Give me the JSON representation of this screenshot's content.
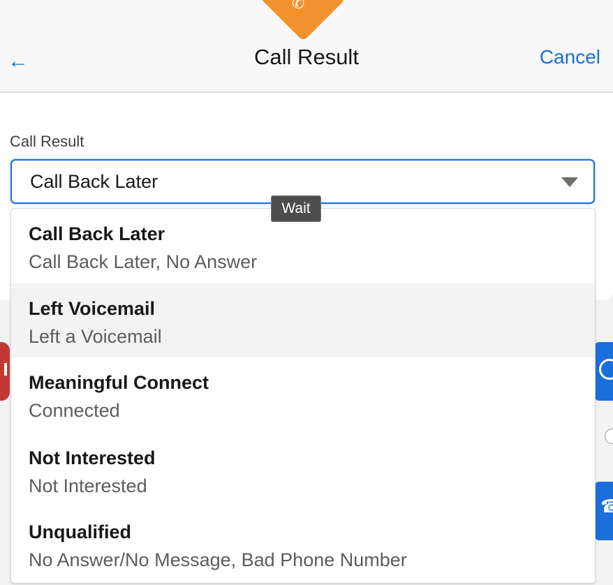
{
  "header": {
    "title": "Call Result",
    "cancel_label": "Cancel",
    "back_icon": "arrow-left-icon",
    "badge_icon": "phone-icon"
  },
  "form": {
    "field_label": "Call Result",
    "selected_value": "Call Back Later"
  },
  "tooltip": {
    "text": "Wait"
  },
  "dropdown": {
    "options": [
      {
        "title": "Call Back Later",
        "subtitle": "Call Back Later, No Answer"
      },
      {
        "title": "Left Voicemail",
        "subtitle": "Left a Voicemail"
      },
      {
        "title": "Meaningful Connect",
        "subtitle": "Connected"
      },
      {
        "title": "Not Interested",
        "subtitle": "Not Interested"
      },
      {
        "title": "Unqualified",
        "subtitle": "No Answer/No Message, Bad Phone Number"
      }
    ]
  },
  "colors": {
    "accent": "#1b6fdc",
    "badge": "#f2922c",
    "danger": "#c23934"
  }
}
